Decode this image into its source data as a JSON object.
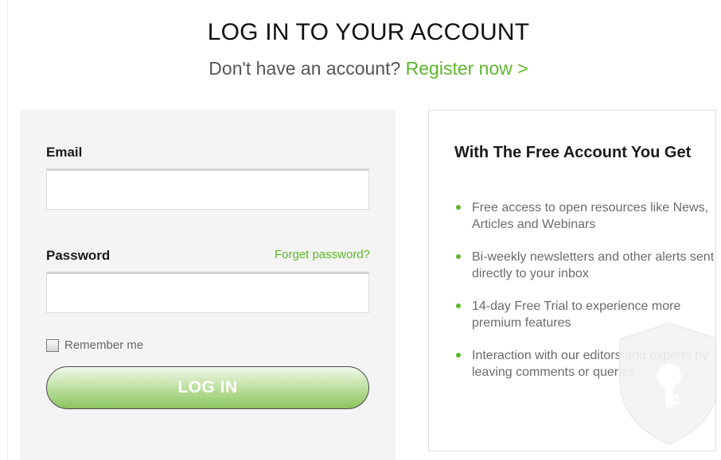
{
  "header": {
    "title": "LOG IN TO YOUR ACCOUNT",
    "subtitle_prefix": "Don't have an account? ",
    "register_link": "Register now >"
  },
  "login_form": {
    "email_label": "Email",
    "email_value": "",
    "password_label": "Password",
    "password_value": "",
    "forgot_link": "Forget password?",
    "remember_label": "Remember me",
    "remember_checked": false,
    "login_button": "LOG IN"
  },
  "benefits_panel": {
    "title": "With The Free Account You Get",
    "items": [
      "Free access to open resources like News, Articles and Webinars",
      "Bi-weekly newsletters and other alerts sent directly to your inbox",
      "14-day Free Trial to experience more premium features",
      "Interaction with our editors and experts by leaving comments or queries"
    ],
    "watermark_icon": "shield-keyhole-icon"
  },
  "colors": {
    "accent_green": "#5cb82a",
    "panel_gray": "#f4f4f4"
  }
}
